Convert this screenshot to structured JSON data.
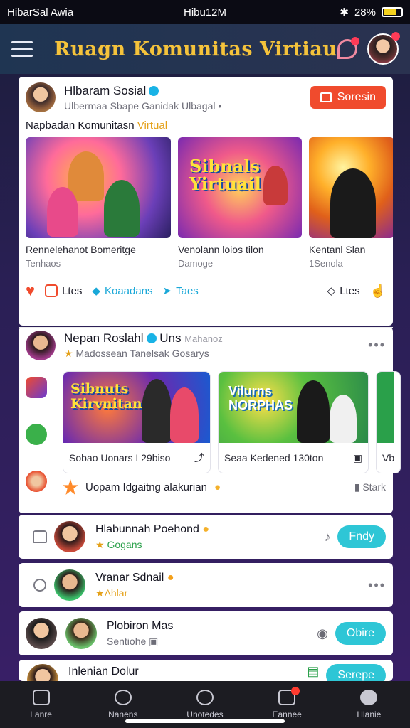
{
  "status_bar": {
    "left": "HibarSal Awia",
    "center": "Hibu12M",
    "battery": "28%"
  },
  "header": {
    "title": "Ruagn Komunitas Virtiau"
  },
  "post1": {
    "title": "Hlbaram Sosial",
    "subtitle": "Ulbermaa Sbape Ganidak Ulbagal •",
    "button": "Soresin",
    "caption_prefix": "Napbadan Komunitasn",
    "caption_highlight": "Virtual",
    "thumb_text": "Sibnals Yirtuail",
    "media": [
      {
        "title": "Rennelehanot Bomeritge",
        "sub": "Tenhaos"
      },
      {
        "title": "Venolann loios tilon",
        "sub": "Damoge"
      },
      {
        "title": "Kentanl Slan",
        "sub": "1Senola"
      }
    ],
    "actions": {
      "a1": "Ltes",
      "a2": "Koaadans",
      "a3": "Taes",
      "a4": "Ltes"
    }
  },
  "post2": {
    "title": "Nepan Roslahl",
    "title_suffix": "Uns",
    "title_extra": "Mahanoz",
    "subtitle": "Madossean Tanelsak Gosarys",
    "more": "•••",
    "thumb1_text": "Sibnuts Kirvnitan",
    "thumb2_text": "Vilurns NORPHAS",
    "tiles": [
      {
        "label": "Sobao Uonars I 29biso"
      },
      {
        "label": "Seaa Kedened 130ton"
      },
      {
        "label": "Vb"
      }
    ],
    "comment": "Uopam Idgaitng alakurian",
    "comment_right": "Stark"
  },
  "list": [
    {
      "title": "Hlabunnah Poehond",
      "sub": "Gogans",
      "button": "Fndy"
    },
    {
      "title": "Vranar Sdnail",
      "sub": "Ahlar",
      "more": "•••"
    },
    {
      "title": "Plobiron Mas",
      "sub": "Sentiohe",
      "button": "Obire"
    },
    {
      "title": "Inlenian Dolur",
      "sub": "",
      "button": "Serepe"
    }
  ],
  "bottom_nav": [
    {
      "label": "Lanre"
    },
    {
      "label": "Nanens"
    },
    {
      "label": "Unotedes"
    },
    {
      "label": "Eannee"
    },
    {
      "label": "Hlanie"
    }
  ],
  "colors": {
    "accent": "#f5c33b",
    "join": "#f04b2d",
    "teal": "#2ec6d6"
  }
}
